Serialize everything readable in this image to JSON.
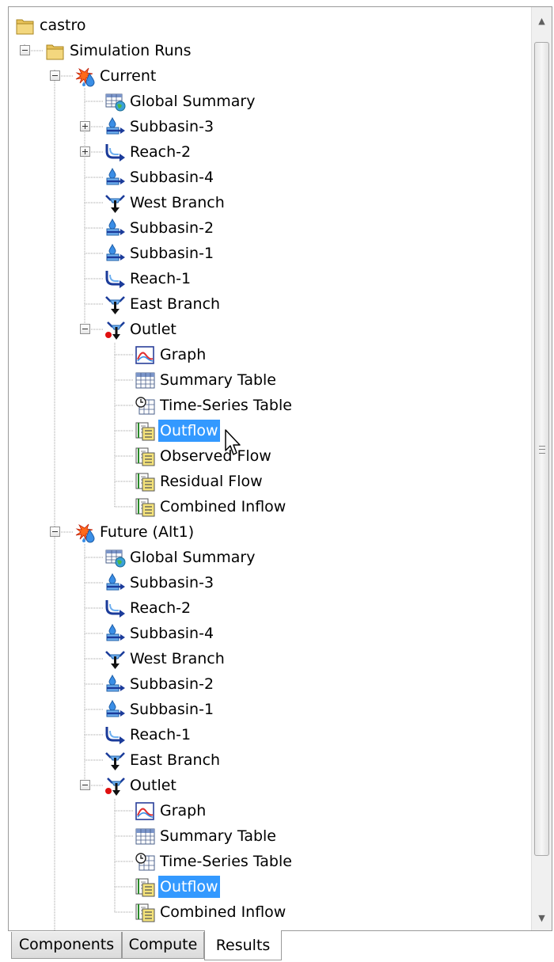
{
  "tree": {
    "root": {
      "label": "castro",
      "icon": "folder-icon"
    },
    "items": [
      {
        "label": "castro",
        "icon": "folder",
        "name": "tree-node-castro"
      },
      {
        "label": "Simulation Runs",
        "icon": "folder",
        "name": "tree-node-simulation-runs"
      },
      {
        "label": "Current",
        "icon": "run",
        "name": "tree-node-current"
      },
      {
        "label": "Global Summary",
        "icon": "global-summary",
        "name": "tree-node-global-summary"
      },
      {
        "label": "Subbasin-3",
        "icon": "subbasin",
        "name": "tree-node-subbasin-3"
      },
      {
        "label": "Reach-2",
        "icon": "reach",
        "name": "tree-node-reach-2"
      },
      {
        "label": "Subbasin-4",
        "icon": "subbasin",
        "name": "tree-node-subbasin-4"
      },
      {
        "label": "West Branch",
        "icon": "junction",
        "name": "tree-node-west-branch"
      },
      {
        "label": "Subbasin-2",
        "icon": "subbasin",
        "name": "tree-node-subbasin-2"
      },
      {
        "label": "Subbasin-1",
        "icon": "subbasin",
        "name": "tree-node-subbasin-1"
      },
      {
        "label": "Reach-1",
        "icon": "reach",
        "name": "tree-node-reach-1"
      },
      {
        "label": "East Branch",
        "icon": "junction",
        "name": "tree-node-east-branch"
      },
      {
        "label": "Outlet",
        "icon": "outlet",
        "name": "tree-node-outlet"
      },
      {
        "label": "Graph",
        "icon": "graph",
        "name": "tree-node-graph"
      },
      {
        "label": "Summary Table",
        "icon": "table",
        "name": "tree-node-summary-table"
      },
      {
        "label": "Time-Series Table",
        "icon": "timeseries",
        "name": "tree-node-time-series-table"
      },
      {
        "label": "Outflow",
        "icon": "result",
        "name": "tree-node-outflow",
        "selected": true
      },
      {
        "label": "Observed Flow",
        "icon": "result",
        "name": "tree-node-observed-flow"
      },
      {
        "label": "Residual Flow",
        "icon": "result",
        "name": "tree-node-residual-flow"
      },
      {
        "label": "Combined Inflow",
        "icon": "result",
        "name": "tree-node-combined-inflow"
      },
      {
        "label": "Future (Alt1)",
        "icon": "run",
        "name": "tree-node-future-alt1"
      },
      {
        "label": "Global Summary",
        "icon": "global-summary",
        "name": "tree-node-global-summary"
      },
      {
        "label": "Subbasin-3",
        "icon": "subbasin",
        "name": "tree-node-subbasin-3"
      },
      {
        "label": "Reach-2",
        "icon": "reach",
        "name": "tree-node-reach-2"
      },
      {
        "label": "Subbasin-4",
        "icon": "subbasin",
        "name": "tree-node-subbasin-4"
      },
      {
        "label": "West Branch",
        "icon": "junction",
        "name": "tree-node-west-branch"
      },
      {
        "label": "Subbasin-2",
        "icon": "subbasin",
        "name": "tree-node-subbasin-2"
      },
      {
        "label": "Subbasin-1",
        "icon": "subbasin",
        "name": "tree-node-subbasin-1"
      },
      {
        "label": "Reach-1",
        "icon": "reach",
        "name": "tree-node-reach-1"
      },
      {
        "label": "East Branch",
        "icon": "junction",
        "name": "tree-node-east-branch"
      },
      {
        "label": "Outlet",
        "icon": "outlet",
        "name": "tree-node-outlet"
      },
      {
        "label": "Graph",
        "icon": "graph",
        "name": "tree-node-graph"
      },
      {
        "label": "Summary Table",
        "icon": "table",
        "name": "tree-node-summary-table"
      },
      {
        "label": "Time-Series Table",
        "icon": "timeseries",
        "name": "tree-node-time-series-table"
      },
      {
        "label": "Outflow",
        "icon": "result",
        "name": "tree-node-outflow",
        "selected": true
      },
      {
        "label": "Combined Inflow",
        "icon": "result",
        "name": "tree-node-combined-inflow"
      }
    ]
  },
  "tabs": [
    {
      "label": "Components",
      "active": false
    },
    {
      "label": "Compute",
      "active": false
    },
    {
      "label": "Results",
      "active": true
    }
  ],
  "colors": {
    "selection": "#3399ff",
    "selection_text": "#ffffff",
    "tree_line": "#a0a0a0"
  }
}
